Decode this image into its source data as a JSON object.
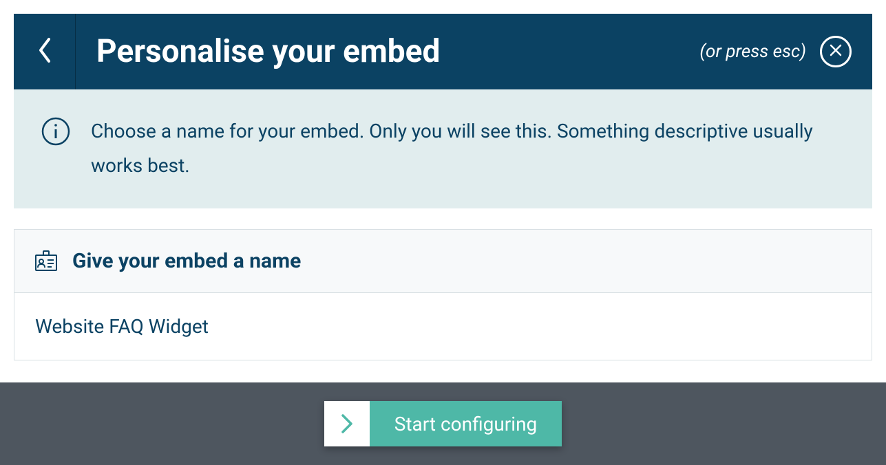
{
  "header": {
    "title": "Personalise your embed",
    "esc_hint": "(or press esc)"
  },
  "info": {
    "text": "Choose a name for your embed. Only you will see this. Something descriptive usually works best."
  },
  "form": {
    "section_title": "Give your embed a name",
    "input_value": "Website FAQ Widget"
  },
  "footer": {
    "cta_label": "Start configuring"
  }
}
